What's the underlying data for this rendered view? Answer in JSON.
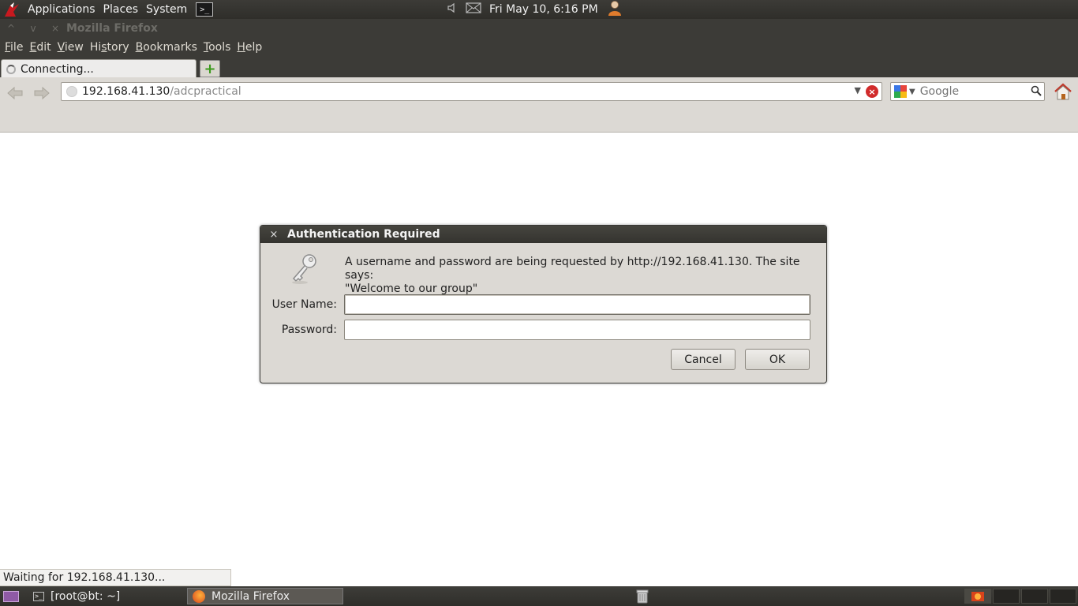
{
  "top_panel": {
    "menus": [
      "Applications",
      "Places",
      "System"
    ],
    "terminal_glyph": ">_",
    "clock": "Fri May 10,  6:16 PM"
  },
  "window": {
    "title": "Mozilla Firefox",
    "menubar": [
      {
        "label": "File",
        "underline": "F",
        "rest": "ile"
      },
      {
        "label": "Edit",
        "underline": "E",
        "rest": "dit"
      },
      {
        "label": "View",
        "underline": "V",
        "rest": "iew"
      },
      {
        "label": "History",
        "pre": "Hi",
        "underline": "s",
        "rest": "tory"
      },
      {
        "label": "Bookmarks",
        "underline": "B",
        "rest": "ookmarks"
      },
      {
        "label": "Tools",
        "underline": "T",
        "rest": "ools"
      },
      {
        "label": "Help",
        "underline": "H",
        "rest": "elp"
      }
    ],
    "tab": {
      "title": "Connecting..."
    },
    "new_tab_glyph": "+",
    "url": {
      "host": "192.168.41.130",
      "path": "/adcpractical"
    },
    "search": {
      "placeholder": "Google"
    },
    "status_text": "Waiting for 192.168.41.130..."
  },
  "dialog": {
    "title": "Authentication Required",
    "close_glyph": "×",
    "message_line1": "A username and password are being requested by http://192.168.41.130. The site says:",
    "message_line2": "\"Welcome to our group\"",
    "username_label": "User Name:",
    "password_label": "Password:",
    "username_value": "",
    "password_value": "",
    "cancel_label": "Cancel",
    "ok_label": "OK"
  },
  "taskbar": {
    "items": [
      {
        "label": "[root@bt: ~]",
        "icon": "terminal-icon"
      },
      {
        "label": "Mozilla Firefox",
        "icon": "firefox-icon",
        "active": true
      }
    ]
  }
}
